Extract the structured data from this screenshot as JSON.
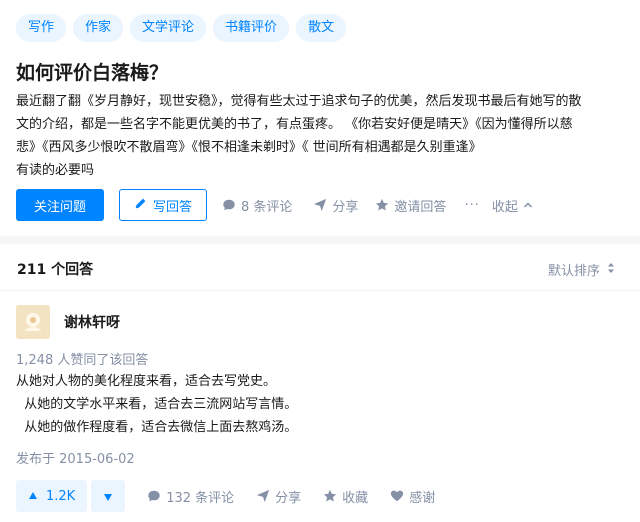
{
  "question": {
    "tags": [
      "写作",
      "作家",
      "文学评论",
      "书籍评价",
      "散文"
    ],
    "title": "如何评价白落梅？",
    "detail": [
      "最近翻了翻《岁月静好，现世安稳》，觉得有些太过于追求句子的优美，然后发现书最后有她写的散",
      "文的介绍，都是一些名字不能更优美的书了，有点蛋疼。 《你若安好便是晴天》《因为懂得所以慈",
      "悲》《西风多少恨吹不散眉弯》《恨不相逢未剃时》《 世间所有相遇都是久别重逢》",
      "有读的必要吗"
    ],
    "follow_label": "关注问题",
    "write_label": "写回答",
    "comments_label": "8 条评论",
    "share_label": "分享",
    "invite_label": "邀请回答",
    "more_label": "···",
    "collapse_label": "收起"
  },
  "answers": {
    "count_label": "211 个回答",
    "sort_label": "默认排序"
  },
  "answer": {
    "author_name": "谢林轩呀",
    "votes_text": "1,248 人赞同了该回答",
    "content": [
      "从她对人物的美化程度来看，适合去写党史。",
      "  从她的文学水平来看，适合去三流网站写言情。",
      "  从她的做作程度看，适合去微信上面去熬鸡汤。"
    ],
    "published": "发布于 2015-06-02",
    "upvote_count": "1.2K",
    "comments_label": "132 条评论",
    "share_label": "分享",
    "favorite_label": "收藏",
    "thanks_label": "感谢"
  },
  "colors": {
    "accent": "#0084ff",
    "accent_bg": "#ebf5ff",
    "meta_gray": "#8590a6",
    "page_bg": "#f6f6f6"
  },
  "icons": [
    "pencil-icon",
    "comment-icon",
    "share-icon",
    "invite-star-icon",
    "chevron-up-icon",
    "sort-icon",
    "upvote-triangle-icon",
    "downvote-triangle-icon",
    "star-icon",
    "heart-icon"
  ]
}
